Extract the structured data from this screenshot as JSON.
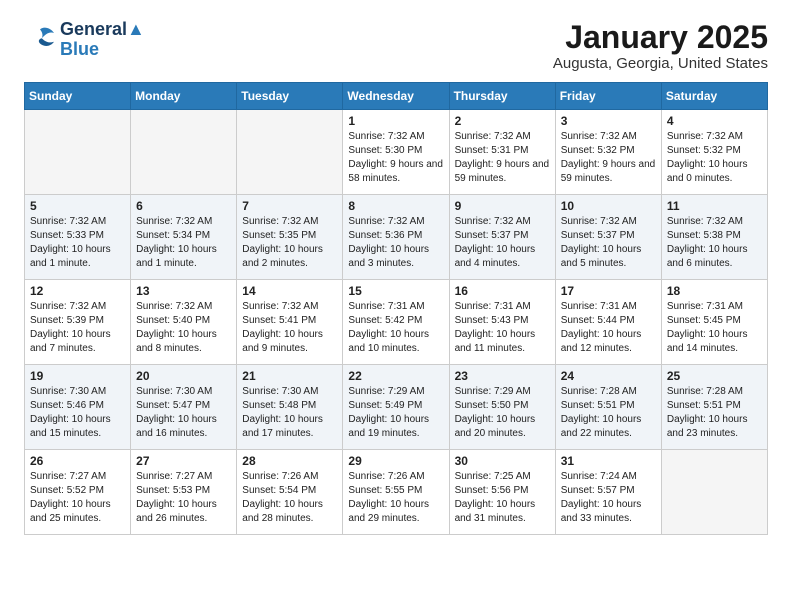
{
  "logo": {
    "line1": "General",
    "line2": "Blue"
  },
  "title": "January 2025",
  "location": "Augusta, Georgia, United States",
  "weekdays": [
    "Sunday",
    "Monday",
    "Tuesday",
    "Wednesday",
    "Thursday",
    "Friday",
    "Saturday"
  ],
  "weeks": [
    [
      {
        "day": "",
        "info": ""
      },
      {
        "day": "",
        "info": ""
      },
      {
        "day": "",
        "info": ""
      },
      {
        "day": "1",
        "info": "Sunrise: 7:32 AM\nSunset: 5:30 PM\nDaylight: 9 hours and 58 minutes."
      },
      {
        "day": "2",
        "info": "Sunrise: 7:32 AM\nSunset: 5:31 PM\nDaylight: 9 hours and 59 minutes."
      },
      {
        "day": "3",
        "info": "Sunrise: 7:32 AM\nSunset: 5:32 PM\nDaylight: 9 hours and 59 minutes."
      },
      {
        "day": "4",
        "info": "Sunrise: 7:32 AM\nSunset: 5:32 PM\nDaylight: 10 hours and 0 minutes."
      }
    ],
    [
      {
        "day": "5",
        "info": "Sunrise: 7:32 AM\nSunset: 5:33 PM\nDaylight: 10 hours and 1 minute."
      },
      {
        "day": "6",
        "info": "Sunrise: 7:32 AM\nSunset: 5:34 PM\nDaylight: 10 hours and 1 minute."
      },
      {
        "day": "7",
        "info": "Sunrise: 7:32 AM\nSunset: 5:35 PM\nDaylight: 10 hours and 2 minutes."
      },
      {
        "day": "8",
        "info": "Sunrise: 7:32 AM\nSunset: 5:36 PM\nDaylight: 10 hours and 3 minutes."
      },
      {
        "day": "9",
        "info": "Sunrise: 7:32 AM\nSunset: 5:37 PM\nDaylight: 10 hours and 4 minutes."
      },
      {
        "day": "10",
        "info": "Sunrise: 7:32 AM\nSunset: 5:37 PM\nDaylight: 10 hours and 5 minutes."
      },
      {
        "day": "11",
        "info": "Sunrise: 7:32 AM\nSunset: 5:38 PM\nDaylight: 10 hours and 6 minutes."
      }
    ],
    [
      {
        "day": "12",
        "info": "Sunrise: 7:32 AM\nSunset: 5:39 PM\nDaylight: 10 hours and 7 minutes."
      },
      {
        "day": "13",
        "info": "Sunrise: 7:32 AM\nSunset: 5:40 PM\nDaylight: 10 hours and 8 minutes."
      },
      {
        "day": "14",
        "info": "Sunrise: 7:32 AM\nSunset: 5:41 PM\nDaylight: 10 hours and 9 minutes."
      },
      {
        "day": "15",
        "info": "Sunrise: 7:31 AM\nSunset: 5:42 PM\nDaylight: 10 hours and 10 minutes."
      },
      {
        "day": "16",
        "info": "Sunrise: 7:31 AM\nSunset: 5:43 PM\nDaylight: 10 hours and 11 minutes."
      },
      {
        "day": "17",
        "info": "Sunrise: 7:31 AM\nSunset: 5:44 PM\nDaylight: 10 hours and 12 minutes."
      },
      {
        "day": "18",
        "info": "Sunrise: 7:31 AM\nSunset: 5:45 PM\nDaylight: 10 hours and 14 minutes."
      }
    ],
    [
      {
        "day": "19",
        "info": "Sunrise: 7:30 AM\nSunset: 5:46 PM\nDaylight: 10 hours and 15 minutes."
      },
      {
        "day": "20",
        "info": "Sunrise: 7:30 AM\nSunset: 5:47 PM\nDaylight: 10 hours and 16 minutes."
      },
      {
        "day": "21",
        "info": "Sunrise: 7:30 AM\nSunset: 5:48 PM\nDaylight: 10 hours and 17 minutes."
      },
      {
        "day": "22",
        "info": "Sunrise: 7:29 AM\nSunset: 5:49 PM\nDaylight: 10 hours and 19 minutes."
      },
      {
        "day": "23",
        "info": "Sunrise: 7:29 AM\nSunset: 5:50 PM\nDaylight: 10 hours and 20 minutes."
      },
      {
        "day": "24",
        "info": "Sunrise: 7:28 AM\nSunset: 5:51 PM\nDaylight: 10 hours and 22 minutes."
      },
      {
        "day": "25",
        "info": "Sunrise: 7:28 AM\nSunset: 5:51 PM\nDaylight: 10 hours and 23 minutes."
      }
    ],
    [
      {
        "day": "26",
        "info": "Sunrise: 7:27 AM\nSunset: 5:52 PM\nDaylight: 10 hours and 25 minutes."
      },
      {
        "day": "27",
        "info": "Sunrise: 7:27 AM\nSunset: 5:53 PM\nDaylight: 10 hours and 26 minutes."
      },
      {
        "day": "28",
        "info": "Sunrise: 7:26 AM\nSunset: 5:54 PM\nDaylight: 10 hours and 28 minutes."
      },
      {
        "day": "29",
        "info": "Sunrise: 7:26 AM\nSunset: 5:55 PM\nDaylight: 10 hours and 29 minutes."
      },
      {
        "day": "30",
        "info": "Sunrise: 7:25 AM\nSunset: 5:56 PM\nDaylight: 10 hours and 31 minutes."
      },
      {
        "day": "31",
        "info": "Sunrise: 7:24 AM\nSunset: 5:57 PM\nDaylight: 10 hours and 33 minutes."
      },
      {
        "day": "",
        "info": ""
      }
    ]
  ]
}
